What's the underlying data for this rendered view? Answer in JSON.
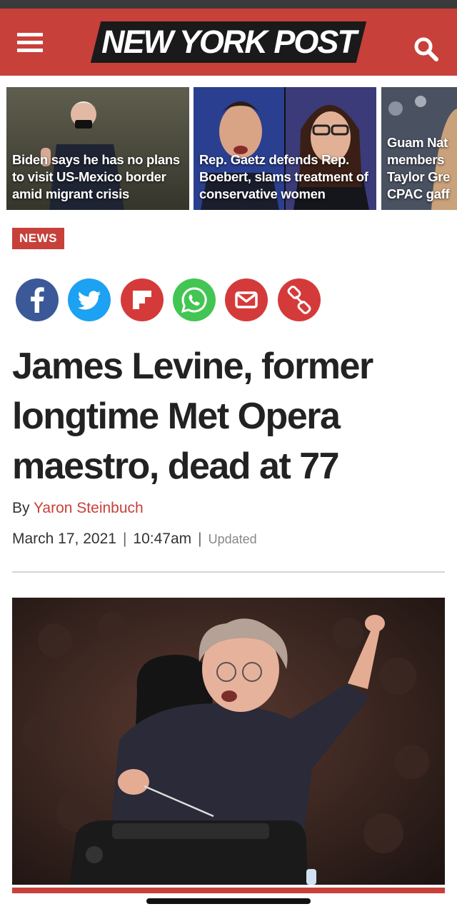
{
  "header": {
    "logo_text": "NEW YORK POST",
    "brand_color": "#c8403a",
    "menu_icon": "hamburger-menu-icon",
    "search_icon": "search-icon"
  },
  "carousel": [
    {
      "caption": "Biden says he has no plans to visit US-Mexico border amid migrant crisis"
    },
    {
      "caption": "Rep. Gaetz defends Rep. Boebert, slams treatment of conservative women"
    },
    {
      "caption": "Guam Nat members Taylor Gre CPAC gaff"
    }
  ],
  "article": {
    "section": "NEWS",
    "headline": "James Levine, former longtime Met Opera maestro, dead at 77",
    "byline_prefix": "By",
    "author": "Yaron Steinbuch",
    "date": "March 17, 2021",
    "time": "10:47am",
    "updated_label": "Updated",
    "separator": "|"
  },
  "share": [
    {
      "name": "facebook-icon",
      "color": "#3b5998"
    },
    {
      "name": "twitter-icon",
      "color": "#1da1f2"
    },
    {
      "name": "flipboard-icon",
      "color": "#d53a3a"
    },
    {
      "name": "whatsapp-icon",
      "color": "#43c553"
    },
    {
      "name": "email-icon",
      "color": "#d53a3a"
    },
    {
      "name": "link-icon",
      "color": "#d53a3a"
    }
  ]
}
